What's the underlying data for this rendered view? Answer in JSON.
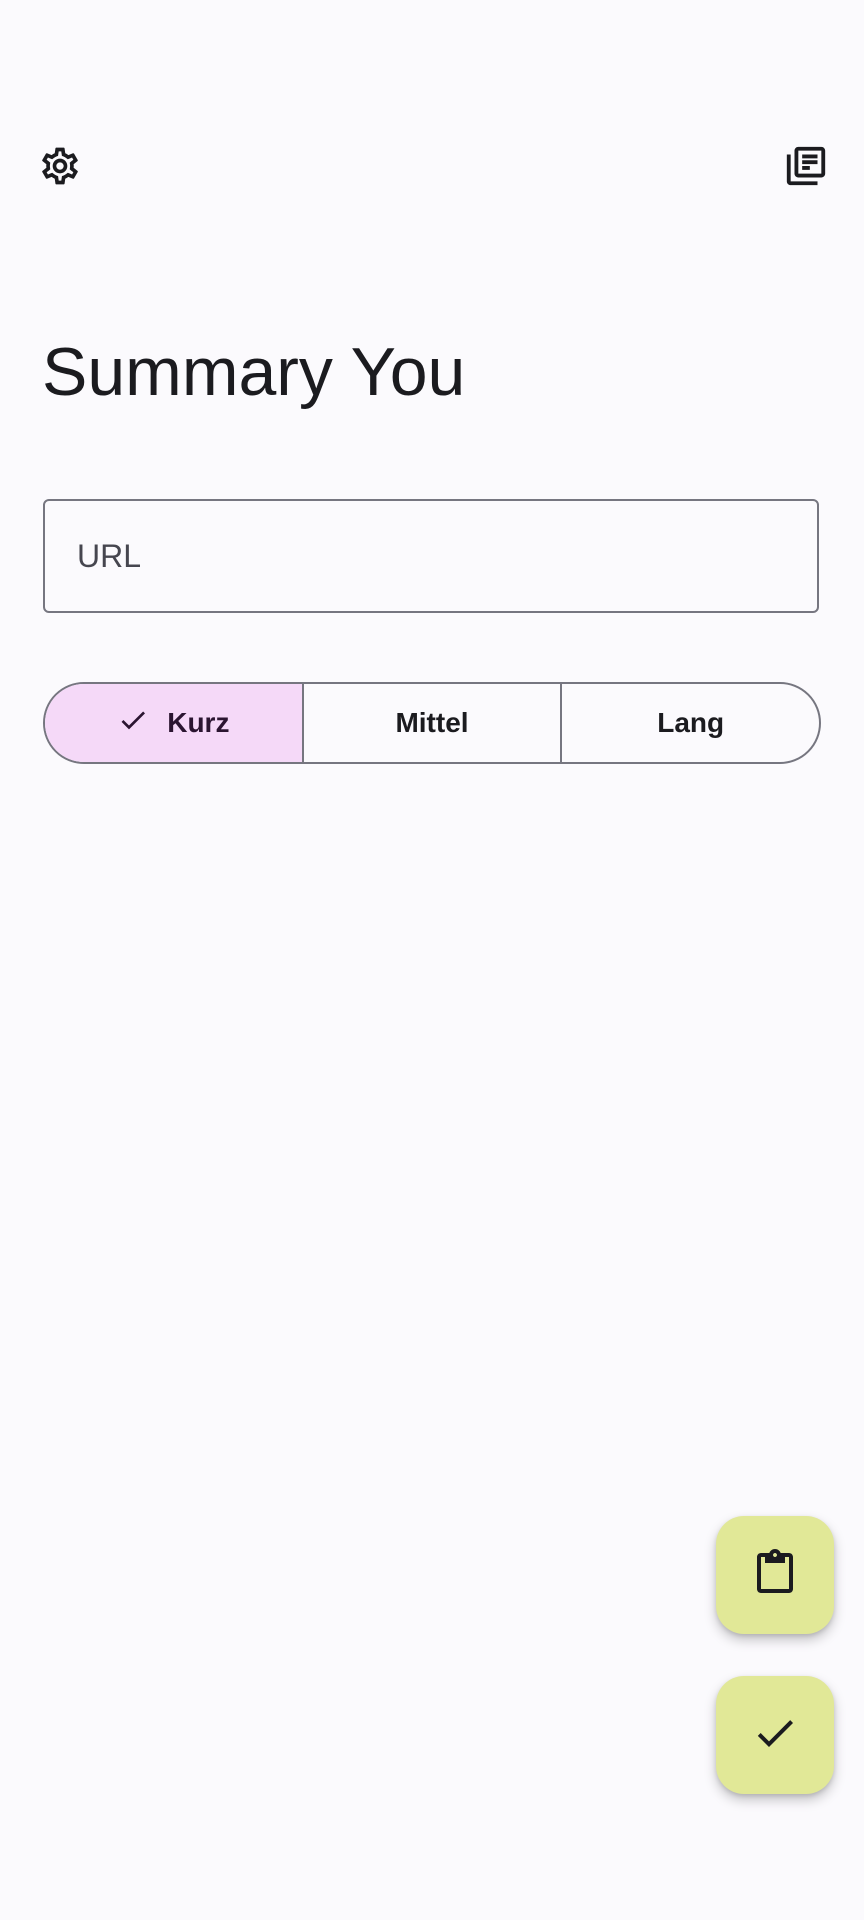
{
  "header": {
    "settings_icon": "gear-icon",
    "history_icon": "article-list-icon"
  },
  "main": {
    "title": "Summary You",
    "url_field": {
      "placeholder": "URL",
      "value": ""
    },
    "length_selector": {
      "options": [
        {
          "label": "Kurz",
          "selected": true
        },
        {
          "label": "Mittel",
          "selected": false
        },
        {
          "label": "Lang",
          "selected": false
        }
      ],
      "selected_color": "#f5d9f8"
    }
  },
  "fabs": {
    "paste_icon": "clipboard-icon",
    "submit_icon": "check-icon",
    "color": "#e1e897"
  }
}
